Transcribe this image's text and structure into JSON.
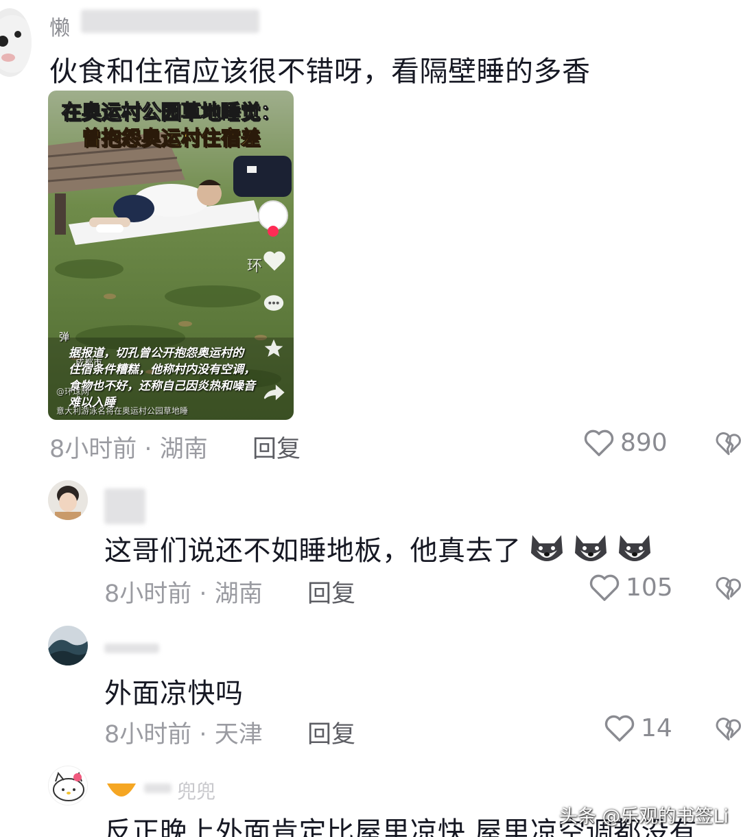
{
  "comments": [
    {
      "username": "懒",
      "text": "伙食和住宿应该很不错呀，看隔壁睡的多香",
      "time": "8小时前",
      "location": "湖南",
      "reply_label": "回复",
      "likes": "890"
    },
    {
      "username": "",
      "text": "这哥们说还不如睡地板，他真去了",
      "time": "8小时前",
      "location": "湖南",
      "reply_label": "回复",
      "likes": "105"
    },
    {
      "username": "",
      "text": "外面凉快吗",
      "time": "8小时前",
      "location": "天津",
      "reply_label": "回复",
      "likes": "14"
    },
    {
      "username": "兜兜",
      "text": "反正晚上外面肯定比屋里凉快 屋里凉空调都没有"
    }
  ],
  "video_card": {
    "title_line1": "在奥运村公园草地睡觉：",
    "title_line2": "曾抱怨奥运村住宿差",
    "caption_line1": "据报道，切孔曾公开抱怨奥运村的",
    "caption_line2": "住宿条件糟糕，他称村内没有空调，",
    "caption_line3": "食物也不好，还称自己因炎热和噪音",
    "caption_line4": "难以入睡",
    "footer": "意大利游泳名将在奥运村公园草地睡",
    "location_tag": "成都市",
    "danmu_label": "弹",
    "side_text": "环",
    "author_tag": "@环球网"
  },
  "watermark": "头条 @乐观的书签Li",
  "dot_separator": "·",
  "colors": {
    "text": "#161823",
    "meta": "#9a9ba1",
    "icon": "#8a8b91"
  }
}
